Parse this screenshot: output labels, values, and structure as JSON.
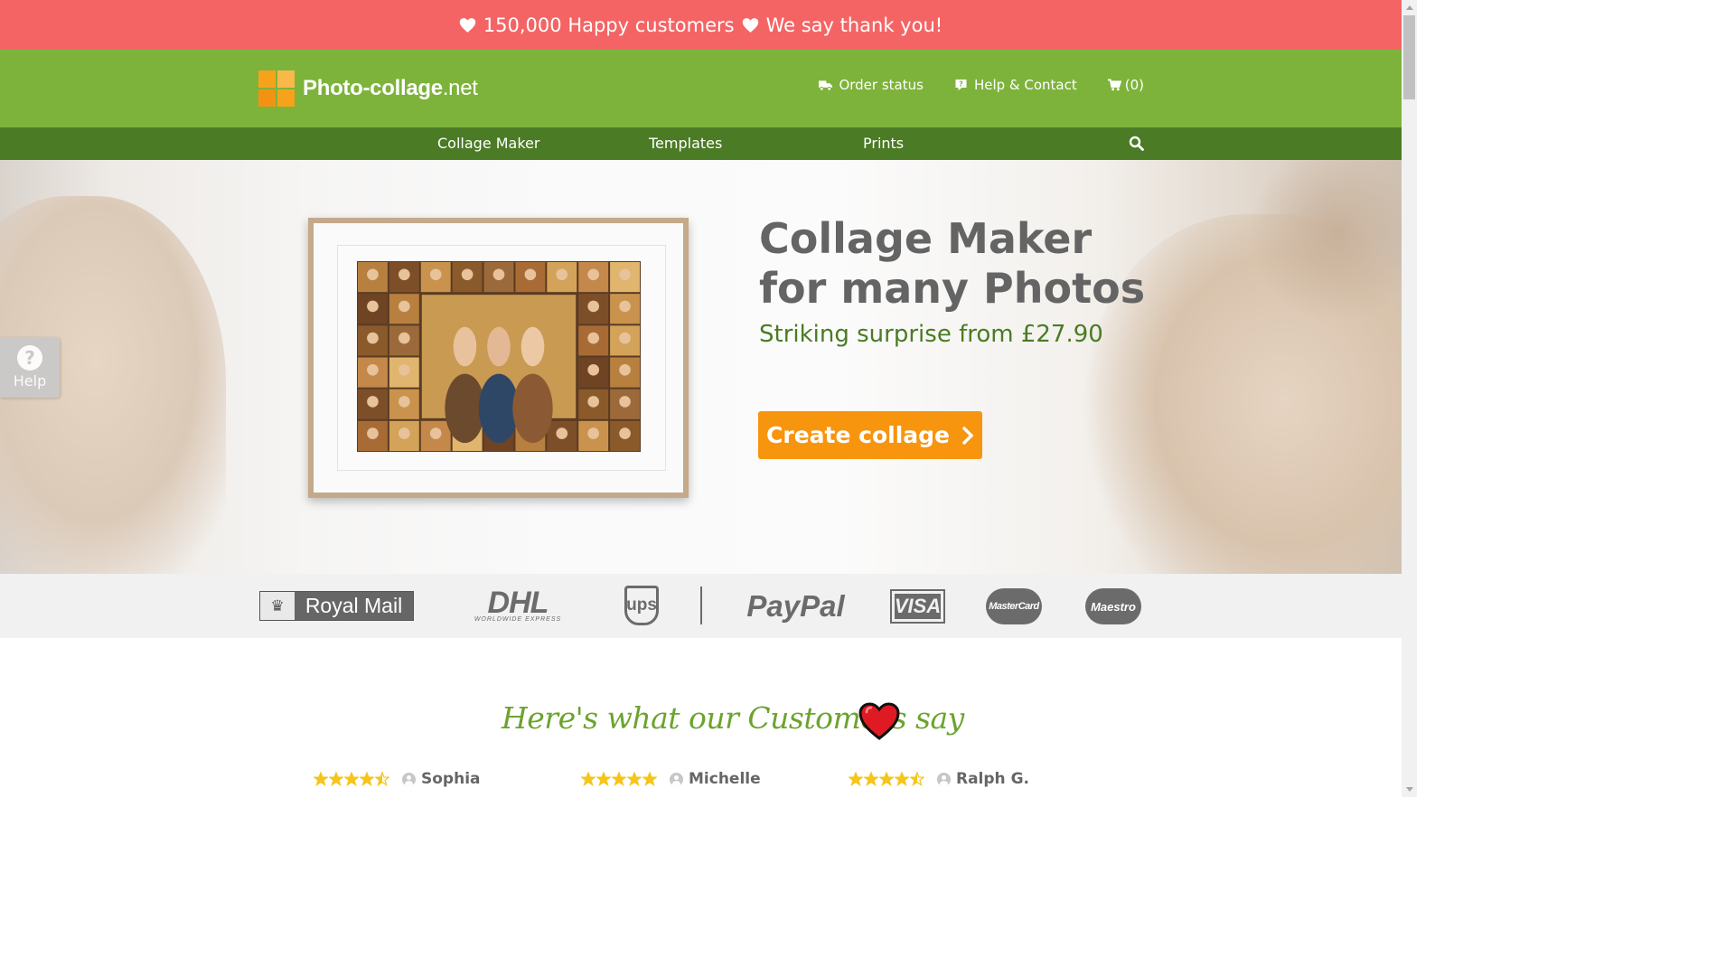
{
  "promo": {
    "text_1": "150,000 Happy customers",
    "text_2": "We say thank you!"
  },
  "logo": {
    "name": "Photo-collage",
    "tld": ".net"
  },
  "header": {
    "order_status": "Order status",
    "help_contact": "Help & Contact",
    "cart": "(0)"
  },
  "nav": {
    "items": [
      "Collage Maker",
      "Templates",
      "Prints"
    ],
    "search_icon": "search-icon"
  },
  "hero": {
    "title_line1": "Collage Maker",
    "title_line2": "for many Photos",
    "subtitle": "Striking surprise from £27.90",
    "cta": "Create collage"
  },
  "help_tab": {
    "icon": "?",
    "label": "Help"
  },
  "partners": {
    "royal_mail": "Royal Mail",
    "dhl": "DHL",
    "dhl_sub": "WORLDWIDE EXPRESS",
    "ups": "ups",
    "paypal": "PayPal",
    "visa": "VISA",
    "mastercard": "MasterCard",
    "maestro": "Maestro"
  },
  "testimonials": {
    "title": "Here's what our Customers say",
    "reviews": [
      {
        "name": "Sophia",
        "rating": 4.5
      },
      {
        "name": "Michelle",
        "rating": 5
      },
      {
        "name": "Ralph G.",
        "rating": 4.5
      }
    ]
  },
  "colors": {
    "promo_bg": "#f56464",
    "header_bg": "#7db33b",
    "nav_bg": "#4b7b25",
    "cta_bg": "#f7950f",
    "star": "#f5c518"
  }
}
